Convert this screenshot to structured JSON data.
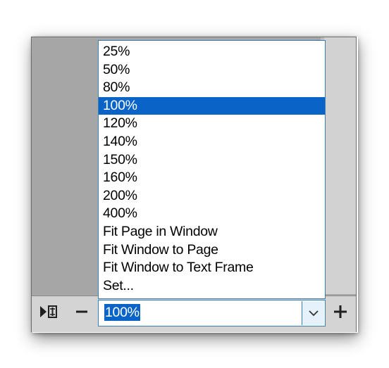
{
  "zoom_menu": {
    "options": [
      {
        "label": "25%"
      },
      {
        "label": "50%"
      },
      {
        "label": "80%"
      },
      {
        "label": "100%",
        "selected": true
      },
      {
        "label": "120%"
      },
      {
        "label": "140%"
      },
      {
        "label": "150%"
      },
      {
        "label": "160%"
      },
      {
        "label": "200%"
      },
      {
        "label": "400%"
      },
      {
        "label": "Fit Page in Window"
      },
      {
        "label": "Fit Window to Page"
      },
      {
        "label": "Fit Window to Text Frame"
      },
      {
        "label": "Set..."
      }
    ]
  },
  "zoom_field": {
    "value": "100%"
  },
  "colors": {
    "selection": "#0a64c8",
    "focus_border": "#3c7fb1",
    "pasteboard": "#a6a6a6",
    "toolbar": "#d4d4d4"
  },
  "icons": {
    "navigate": "story-navigate-icon",
    "zoom_out": "minus-icon",
    "dropdown": "chevron-down-icon",
    "zoom_in": "plus-icon"
  }
}
